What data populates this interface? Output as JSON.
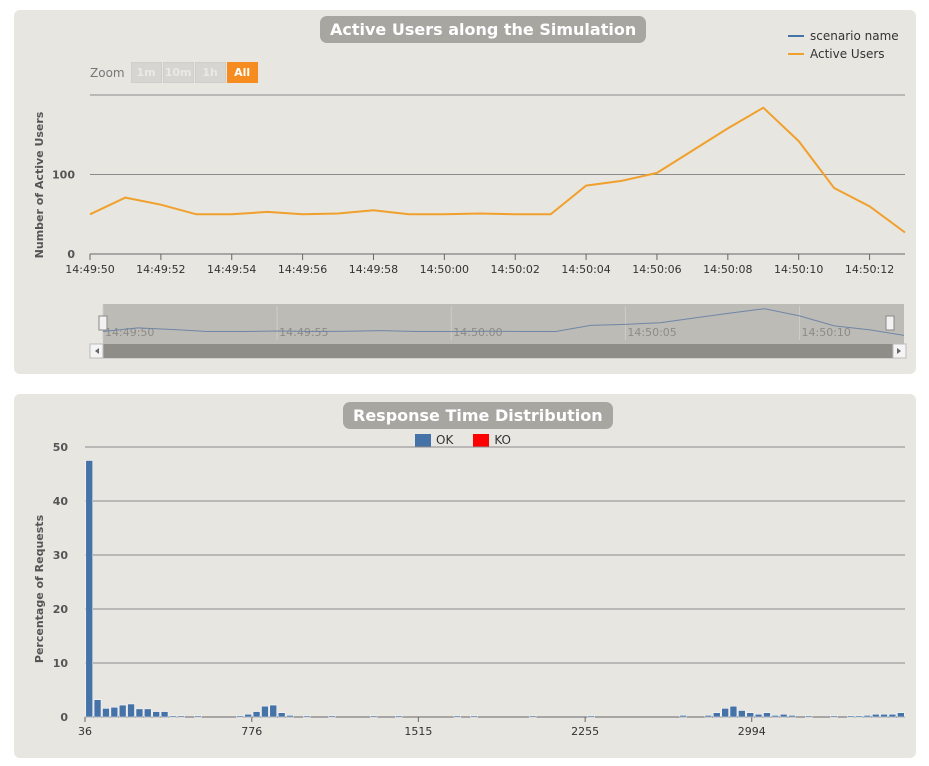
{
  "colors": {
    "ok": "#4572a7",
    "ko": "#ff0000",
    "active_users": "#f0a02c",
    "scenario": "#4572a7",
    "zoom_active": "#f68b1f"
  },
  "active_users_panel": {
    "title": "Active Users along the Simulation",
    "zoom_label": "Zoom",
    "zoom_buttons": [
      {
        "label": "1m",
        "active": false
      },
      {
        "label": "10m",
        "active": false
      },
      {
        "label": "1h",
        "active": false
      },
      {
        "label": "All",
        "active": true
      }
    ],
    "legend": [
      {
        "label": "scenario name",
        "color": "#4572a7"
      },
      {
        "label": "Active Users",
        "color": "#f0a02c"
      }
    ],
    "navigator_ticks": [
      "14:49:50",
      "14:49:55",
      "14:50:00",
      "14:50:05",
      "14:50:10"
    ]
  },
  "response_panel": {
    "title": "Response Time Distribution",
    "legend": [
      {
        "label": "OK",
        "color": "#4572a7"
      },
      {
        "label": "KO",
        "color": "#ff0000"
      }
    ]
  },
  "chart_data": [
    {
      "type": "line",
      "title": "Active Users along the Simulation",
      "ylabel": "Number of Active Users",
      "xlabel": "",
      "ylim": [
        0,
        200
      ],
      "yticks": [
        0,
        100
      ],
      "xticks": [
        "14:49:50",
        "14:49:52",
        "14:49:54",
        "14:49:56",
        "14:49:58",
        "14:50:00",
        "14:50:02",
        "14:50:04",
        "14:50:06",
        "14:50:08",
        "14:50:10",
        "14:50:12"
      ],
      "x": [
        "14:49:50",
        "14:49:51",
        "14:49:52",
        "14:49:53",
        "14:49:54",
        "14:49:55",
        "14:49:56",
        "14:49:57",
        "14:49:58",
        "14:49:59",
        "14:50:00",
        "14:50:01",
        "14:50:02",
        "14:50:03",
        "14:50:04",
        "14:50:05",
        "14:50:06",
        "14:50:07",
        "14:50:08",
        "14:50:09",
        "14:50:10",
        "14:50:11",
        "14:50:12",
        "14:50:13"
      ],
      "series": [
        {
          "name": "Active Users",
          "values": [
            50,
            71,
            62,
            50,
            50,
            53,
            50,
            51,
            55,
            50,
            50,
            51,
            50,
            50,
            86,
            92,
            102,
            130,
            158,
            184,
            142,
            83,
            60,
            27
          ]
        }
      ],
      "grid": true,
      "legend_position": "top-right"
    },
    {
      "type": "bar",
      "title": "Response Time Distribution",
      "ylabel": "Percentage of Requests",
      "xlabel": "",
      "ylim": [
        0,
        50
      ],
      "yticks": [
        0,
        10,
        20,
        30,
        40,
        50
      ],
      "xticks": [
        "36",
        "776",
        "1515",
        "2255",
        "2994"
      ],
      "xrange": [
        36,
        3674
      ],
      "x": [
        36,
        73,
        110,
        147,
        184,
        221,
        258,
        295,
        332,
        369,
        406,
        443,
        480,
        517,
        554,
        591,
        628,
        665,
        702,
        739,
        776,
        813,
        850,
        887,
        924,
        961,
        998,
        1035,
        1072,
        1109,
        1146,
        1183,
        1220,
        1257,
        1294,
        1331,
        1368,
        1405,
        1442,
        1479,
        1516,
        1553,
        1590,
        1627,
        1664,
        1701,
        1738,
        1775,
        1812,
        1849,
        1886,
        1923,
        1960,
        1997,
        2034,
        2071,
        2108,
        2145,
        2182,
        2219,
        2256,
        2293,
        2330,
        2367,
        2404,
        2441,
        2478,
        2515,
        2552,
        2589,
        2626,
        2663,
        2700,
        2737,
        2774,
        2811,
        2848,
        2885,
        2922,
        2959,
        2996,
        3033,
        3070,
        3107,
        3144,
        3181,
        3218,
        3255,
        3292,
        3329,
        3366,
        3403,
        3440,
        3477,
        3514,
        3551,
        3588,
        3625
      ],
      "series": [
        {
          "name": "OK",
          "values": [
            47.5,
            3.2,
            1.6,
            1.8,
            2.2,
            2.4,
            1.5,
            1.5,
            1.0,
            1.0,
            0.2,
            0.2,
            0,
            0.2,
            0,
            0,
            0,
            0,
            0.2,
            0.5,
            1.0,
            2.0,
            2.2,
            0.8,
            0.3,
            0,
            0.2,
            0,
            0,
            0.2,
            0,
            0,
            0,
            0,
            0.2,
            0,
            0,
            0.2,
            0,
            0,
            0,
            0,
            0,
            0,
            0.2,
            0,
            0.2,
            0,
            0,
            0,
            0,
            0,
            0,
            0.2,
            0,
            0,
            0,
            0,
            0,
            0,
            0.2,
            0,
            0,
            0,
            0,
            0,
            0,
            0,
            0,
            0,
            0,
            0.3,
            0,
            0,
            0.3,
            0.8,
            1.6,
            2.0,
            1.2,
            0.8,
            0.5,
            0.8,
            0.3,
            0.5,
            0.3,
            0,
            0.2,
            0,
            0,
            0.2,
            0,
            0.2,
            0.2,
            0.3,
            0.5,
            0.5,
            0.5,
            0.8,
            0.3
          ]
        },
        {
          "name": "KO",
          "values": []
        }
      ],
      "grid": true,
      "legend_position": "top"
    }
  ]
}
